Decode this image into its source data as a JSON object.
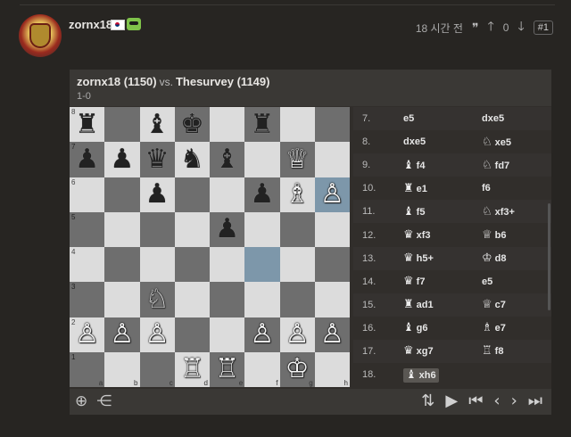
{
  "post": {
    "username": "zornx18",
    "time_ago": "18 시간 전",
    "quote_icon": "quote-icon",
    "votes": "0",
    "post_number": "#1"
  },
  "game": {
    "white_player": "zornx18 (1150)",
    "vs": "vs.",
    "black_player": "Thesurvey (1149)",
    "result": "1-0"
  },
  "board": {
    "files": [
      "a",
      "b",
      "c",
      "d",
      "e",
      "f",
      "g",
      "h"
    ],
    "ranks": [
      "8",
      "7",
      "6",
      "5",
      "4",
      "3",
      "2",
      "1"
    ],
    "highlight_squares": [
      "h6",
      "f4"
    ],
    "rows": [
      [
        {
          "c": "b",
          "p": "♜"
        },
        null,
        {
          "c": "b",
          "p": "♝"
        },
        {
          "c": "b",
          "p": "♚"
        },
        null,
        {
          "c": "b",
          "p": "♜"
        },
        null,
        null
      ],
      [
        {
          "c": "b",
          "p": "♟"
        },
        {
          "c": "b",
          "p": "♟"
        },
        {
          "c": "b",
          "p": "♛"
        },
        {
          "c": "b",
          "p": "♞"
        },
        {
          "c": "b",
          "p": "♝"
        },
        null,
        {
          "c": "w",
          "p": "♕"
        },
        null
      ],
      [
        null,
        null,
        {
          "c": "b",
          "p": "♟"
        },
        null,
        null,
        {
          "c": "b",
          "p": "♟"
        },
        {
          "c": "w",
          "p": "♗"
        },
        {
          "c": "w",
          "p": "♙"
        }
      ],
      [
        null,
        null,
        null,
        null,
        {
          "c": "b",
          "p": "♟"
        },
        null,
        null,
        null
      ],
      [
        null,
        null,
        null,
        null,
        null,
        null,
        null,
        null
      ],
      [
        null,
        null,
        {
          "c": "w",
          "p": "♘"
        },
        null,
        null,
        null,
        null,
        null
      ],
      [
        {
          "c": "w",
          "p": "♙"
        },
        {
          "c": "w",
          "p": "♙"
        },
        {
          "c": "w",
          "p": "♙"
        },
        null,
        null,
        {
          "c": "w",
          "p": "♙"
        },
        {
          "c": "w",
          "p": "♙"
        },
        {
          "c": "w",
          "p": "♙"
        }
      ],
      [
        null,
        null,
        null,
        {
          "c": "w",
          "p": "♖"
        },
        {
          "c": "w",
          "p": "♖"
        },
        null,
        {
          "c": "w",
          "p": "♔"
        },
        null
      ]
    ]
  },
  "moves": [
    {
      "n": "7.",
      "w": "e5",
      "ws": "",
      "b": "dxe5",
      "bs": ""
    },
    {
      "n": "8.",
      "w": "dxe5",
      "ws": "",
      "b": "xe5",
      "bs": "♘"
    },
    {
      "n": "9.",
      "w": "f4",
      "ws": "♝",
      "b": "fd7",
      "bs": "♘"
    },
    {
      "n": "10.",
      "w": "e1",
      "ws": "♜",
      "b": "f6",
      "bs": ""
    },
    {
      "n": "11.",
      "w": "f5",
      "ws": "♝",
      "b": "xf3+",
      "bs": "♘"
    },
    {
      "n": "12.",
      "w": "xf3",
      "ws": "♛",
      "b": "b6",
      "bs": "♕"
    },
    {
      "n": "13.",
      "w": "h5+",
      "ws": "♛",
      "b": "d8",
      "bs": "♔"
    },
    {
      "n": "14.",
      "w": "f7",
      "ws": "♛",
      "b": "e5",
      "bs": ""
    },
    {
      "n": "15.",
      "w": "ad1",
      "ws": "♜",
      "b": "c7",
      "bs": "♕"
    },
    {
      "n": "16.",
      "w": "g6",
      "ws": "♝",
      "b": "e7",
      "bs": "♗"
    },
    {
      "n": "17.",
      "w": "xg7",
      "ws": "♛",
      "b": "f8",
      "bs": "♖"
    },
    {
      "n": "18.",
      "w": "xh6",
      "ws": "♝",
      "b": "",
      "bs": "",
      "current": true
    }
  ],
  "controls": {
    "left": [
      {
        "name": "analyze-icon",
        "glyph": "⊕"
      },
      {
        "name": "share-icon",
        "glyph": "⋲"
      }
    ],
    "right": [
      {
        "name": "flip-board-icon",
        "glyph": "⇅"
      },
      {
        "name": "play-icon",
        "glyph": "▶"
      },
      {
        "name": "first-move-icon",
        "glyph": "⏮"
      },
      {
        "name": "prev-move-icon",
        "glyph": "‹"
      },
      {
        "name": "next-move-icon",
        "glyph": "›"
      },
      {
        "name": "last-move-icon",
        "glyph": "⏭"
      }
    ]
  }
}
